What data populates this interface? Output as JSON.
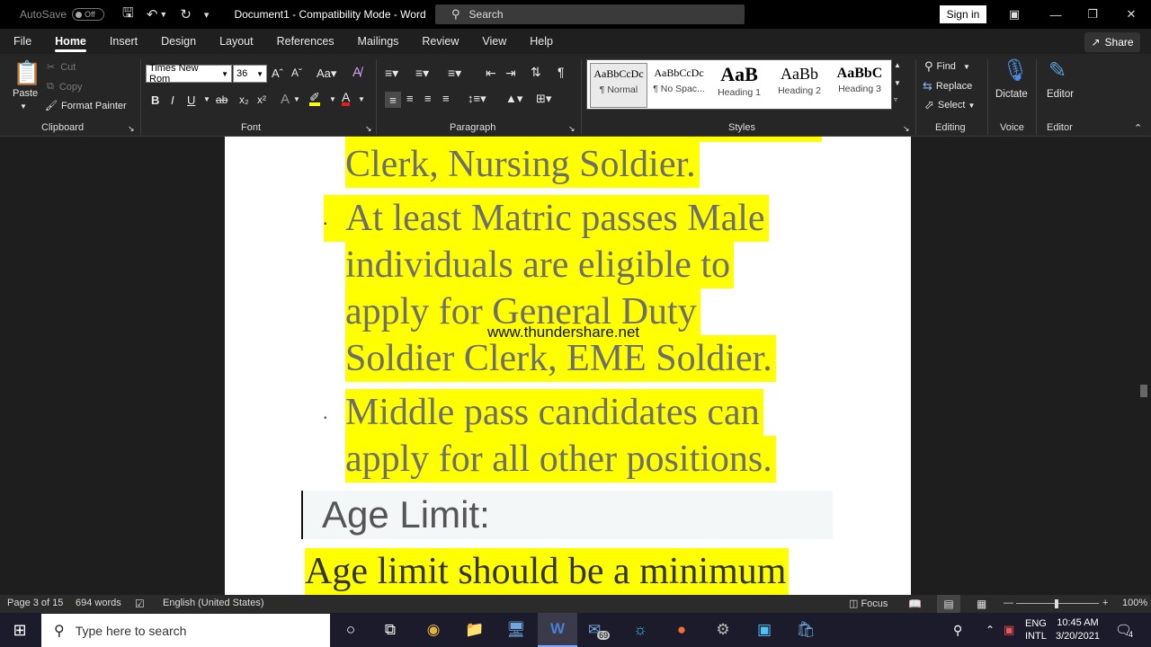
{
  "titlebar": {
    "autosave_label": "AutoSave",
    "autosave_state": "Off",
    "doc_title": "Document1  -  Compatibility Mode  -  Word",
    "search_label": "Search",
    "signin_label": "Sign in"
  },
  "tabs": [
    "File",
    "Home",
    "Insert",
    "Design",
    "Layout",
    "References",
    "Mailings",
    "Review",
    "View",
    "Help"
  ],
  "share_label": "Share",
  "ribbon": {
    "clipboard": {
      "paste": "Paste",
      "cut": "Cut",
      "copy": "Copy",
      "format_painter": "Format Painter",
      "label": "Clipboard"
    },
    "font": {
      "name": "Times New Rom",
      "size": "36",
      "label": "Font"
    },
    "paragraph": {
      "label": "Paragraph"
    },
    "styles": {
      "label": "Styles",
      "items": [
        {
          "preview": "AaBbCcDc",
          "name": "¶ Normal"
        },
        {
          "preview": "AaBbCcDc",
          "name": "¶ No Spac..."
        },
        {
          "preview": "AaB",
          "name": "Heading 1"
        },
        {
          "preview": "AaBb",
          "name": "Heading 2"
        },
        {
          "preview": "AaBbC",
          "name": "Heading 3"
        }
      ]
    },
    "editing": {
      "find": "Find",
      "replace": "Replace",
      "select": "Select",
      "label": "Editing"
    },
    "voice": {
      "dictate": "Dictate",
      "label": "Voice"
    },
    "editor": {
      "editor": "Editor",
      "label": "Editor"
    }
  },
  "document": {
    "lines": [
      "Clerk, Nursing Soldier.",
      "At least Matric passes Male",
      "individuals are eligible to",
      "apply for General Duty",
      "Soldier Clerk, EME Soldier.",
      "Middle pass candidates can",
      "apply for all other positions."
    ],
    "heading": "Age Limit:",
    "body": "Age limit should be a minimum",
    "watermark": "www.thundershare.net"
  },
  "statusbar": {
    "page": "Page 3 of 15",
    "words": "694 words",
    "language": "English (United States)",
    "focus": "Focus",
    "zoom": "100%"
  },
  "taskbar": {
    "search_placeholder": "Type here to search",
    "mail_badge": "69",
    "lang": "ENG",
    "layout": "INTL",
    "time": "10:45 AM",
    "date": "3/20/2021",
    "notif_count": "4"
  }
}
